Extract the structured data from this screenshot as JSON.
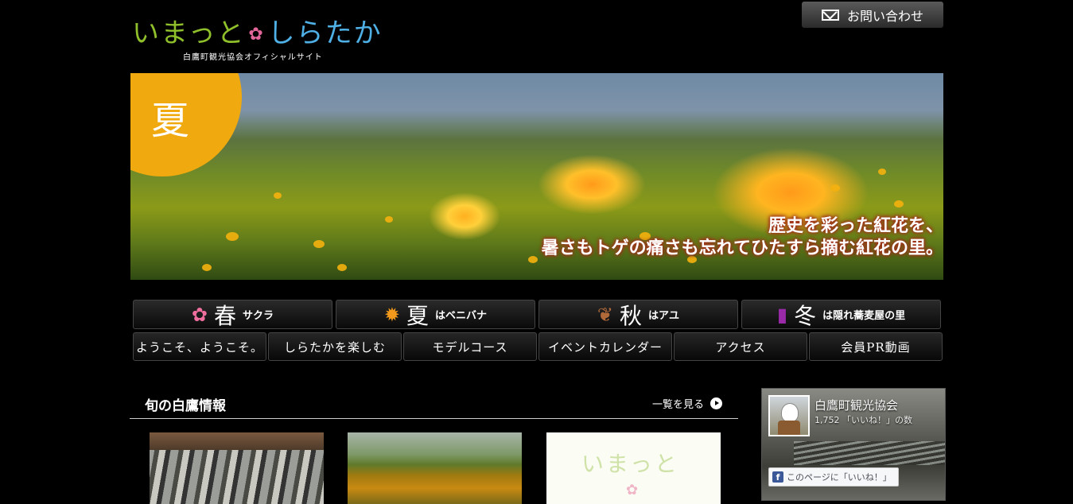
{
  "header": {
    "logo_part1": "いまっと",
    "logo_part2": "しらたか",
    "logo_flower": "✿",
    "tagline": "白鷹町観光協会オフィシャルサイト",
    "contact_label": "お問い合わせ"
  },
  "hero": {
    "season_kanji": "夏",
    "caption_line1": "歴史を彩った紅花を、",
    "caption_line2": "暑さもトゲの痛さも忘れてひたすら摘む紅花の里。"
  },
  "season_nav": [
    {
      "icon": "✿",
      "kanji": "春",
      "label": "サクラ",
      "icon_color": "#f06e9e"
    },
    {
      "icon": "✹",
      "kanji": "夏",
      "label": "はベニバナ",
      "icon_color": "#f39a1c"
    },
    {
      "icon": "❦",
      "kanji": "秋",
      "label": "はアユ",
      "icon_color": "#b06a3a"
    },
    {
      "icon": "▮",
      "kanji": "冬",
      "label": "は隠れ蕎麦屋の里",
      "icon_color": "#9a2aa8"
    }
  ],
  "sub_nav": [
    "ようこそ、ようこそ。",
    "しらたかを楽しむ",
    "モデルコース",
    "イベントカレンダー",
    "アクセス",
    "会員PR動画"
  ],
  "info": {
    "title": "旬の白鷹情報",
    "more_label": "一覧を見る",
    "thumb3_text": "いまっと",
    "thumb3_flower": "✿"
  },
  "facebook": {
    "page_name": "白鷹町観光協会",
    "likes_text": "1,752 「いいね！」の数",
    "like_button": "このページに「いいね！」",
    "f_glyph": "f"
  },
  "colors": {
    "logo_green": "#8fbf2a",
    "logo_blue": "#4fb0e6",
    "season_circle": "#f0a90f",
    "caption_glow": "#a0301a"
  }
}
